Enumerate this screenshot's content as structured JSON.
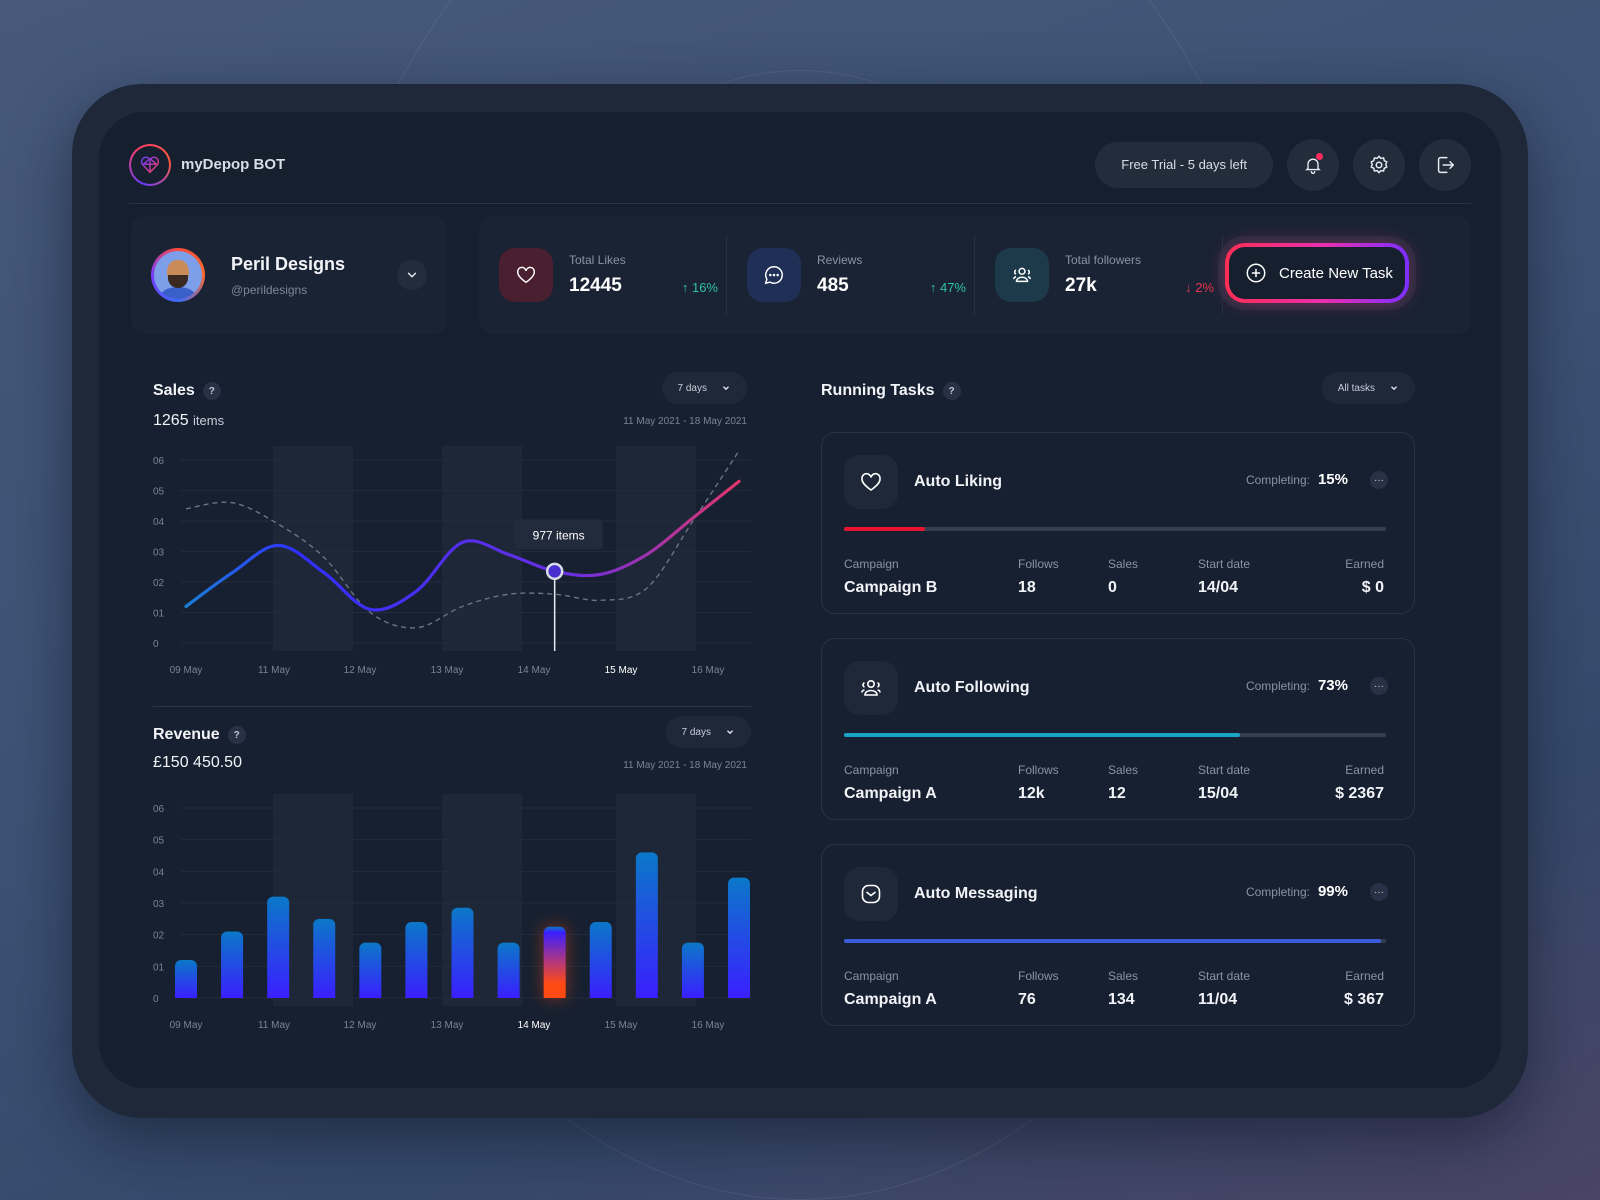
{
  "app": {
    "title": "myDepop BOT"
  },
  "header": {
    "trial_label": "Free Trial - 5 days left",
    "notification_color": "#ff2b5e"
  },
  "profile": {
    "name": "Peril Designs",
    "handle": "@perildesigns"
  },
  "stats": [
    {
      "label": "Total Likes",
      "value": "12445",
      "change": "16%",
      "direction": "up",
      "icon": "heart-icon",
      "icon_bg": "#4a1f2f"
    },
    {
      "label": "Reviews",
      "value": "485",
      "change": "47%",
      "direction": "up",
      "icon": "chat-bubble-icon",
      "icon_bg": "#1f2f55"
    },
    {
      "label": "Total followers",
      "value": "27k",
      "change": "2%",
      "direction": "down",
      "icon": "users-icon",
      "icon_bg": "#1c3a4a"
    }
  ],
  "create_task": {
    "label": "Create New Task"
  },
  "sales": {
    "title": "Sales",
    "help": "?",
    "total_value": "1265",
    "total_unit": "items",
    "period": "7 days",
    "range": "11 May 2021 - 18 May 2021",
    "tooltip": "977 items"
  },
  "revenue": {
    "title": "Revenue",
    "help": "?",
    "total": "£150 450.50",
    "period": "7 days",
    "range": "11 May 2021 - 18 May 2021"
  },
  "chart_data": [
    {
      "type": "line",
      "title": "Sales",
      "x": [
        "09 May",
        "11 May",
        "12 May",
        "13 May",
        "14 May",
        "15 May",
        "16 May"
      ],
      "y_ticks": [
        "0",
        "01",
        "02",
        "03",
        "04",
        "05",
        "06"
      ],
      "ylim": [
        0,
        6
      ],
      "highlighted_x": "15 May",
      "series": [
        {
          "name": "current",
          "style": "solid-gradient",
          "points": [
            [
              0,
              1.2
            ],
            [
              0.5,
              2.3
            ],
            [
              1,
              3.2
            ],
            [
              1.5,
              2.3
            ],
            [
              2,
              1.1
            ],
            [
              2.5,
              1.7
            ],
            [
              3,
              3.3
            ],
            [
              3.5,
              2.9
            ],
            [
              4,
              2.35
            ],
            [
              4.5,
              2.25
            ],
            [
              5,
              2.9
            ],
            [
              5.5,
              4.1
            ],
            [
              6,
              5.3
            ]
          ]
        },
        {
          "name": "previous",
          "style": "dashed",
          "points": [
            [
              0,
              4.4
            ],
            [
              0.5,
              4.6
            ],
            [
              1,
              3.9
            ],
            [
              1.5,
              2.8
            ],
            [
              2,
              1.0
            ],
            [
              2.5,
              0.5
            ],
            [
              3,
              1.2
            ],
            [
              3.5,
              1.6
            ],
            [
              4,
              1.6
            ],
            [
              4.5,
              1.4
            ],
            [
              5,
              1.8
            ],
            [
              5.5,
              4.0
            ],
            [
              6,
              6.3
            ]
          ]
        }
      ],
      "tooltip": {
        "x_index": 4,
        "value": 2.35,
        "label": "977 items"
      }
    },
    {
      "type": "bar",
      "title": "Revenue",
      "categories": [
        "09 May",
        "11 May",
        "12 May",
        "13 May",
        "14 May",
        "15 May",
        "16 May"
      ],
      "y_ticks": [
        "0",
        "01",
        "02",
        "03",
        "04",
        "05",
        "06"
      ],
      "ylim": [
        0,
        6
      ],
      "highlighted_category": "14 May",
      "values": [
        1.2,
        2.1,
        3.2,
        2.5,
        1.75,
        2.4,
        2.85,
        1.75,
        2.25,
        2.4,
        4.6,
        1.75,
        3.8
      ],
      "highlighted_bar_index": 8
    }
  ],
  "tasks": {
    "title": "Running Tasks",
    "help": "?",
    "filter": "All tasks",
    "completing_label": "Completing:",
    "columns": [
      "Campaign",
      "Follows",
      "Sales",
      "Start date",
      "Earned"
    ],
    "items": [
      {
        "name": "Auto Liking",
        "icon": "heart-icon",
        "progress": 15,
        "progress_label": "15%",
        "color": "#e8142e",
        "campaign": "Campaign B",
        "follows": "18",
        "sales": "0",
        "start": "14/04",
        "earned": "$ 0"
      },
      {
        "name": "Auto Following",
        "icon": "users-icon",
        "progress": 73,
        "progress_label": "73%",
        "color": "#1aa4c8",
        "campaign": "Campaign A",
        "follows": "12k",
        "sales": "12",
        "start": "15/04",
        "earned": "$ 2367"
      },
      {
        "name": "Auto Messaging",
        "icon": "message-inbox-icon",
        "progress": 99,
        "progress_label": "99%",
        "color": "#3b5bd8",
        "campaign": "Campaign A",
        "follows": "76",
        "sales": "134",
        "start": "11/04",
        "earned": "$ 367"
      }
    ]
  }
}
